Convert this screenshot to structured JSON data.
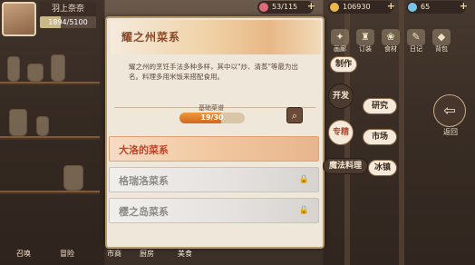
{
  "player": {
    "name": "羽上奈奈",
    "exp_text": "1894/5100",
    "exp_fraction": 0.371
  },
  "resources": [
    {
      "name": "heart-icon",
      "value": "53/115",
      "color": "#e06a7a"
    },
    {
      "name": "coin-icon",
      "value": "106930",
      "color": "#e8b94a"
    },
    {
      "name": "diamond-icon",
      "value": "65",
      "color": "#7ac4e8"
    }
  ],
  "panel": {
    "title": "耀之州菜系",
    "description": "耀之州的烹饪手法多种多样，其中以\"炒、清蒸\"等最为出名。料理多用米饭来搭配食用。",
    "basic_label": "基础菜谱",
    "progress_text": "19/30",
    "progress_fraction": 0.633
  },
  "cuisines": [
    {
      "label": "大洛的菜系",
      "state": "active"
    },
    {
      "label": "格瑞洛菜系",
      "state": "locked"
    },
    {
      "label": "樱之岛菜系",
      "state": "locked"
    }
  ],
  "top_menu": [
    "画廊",
    "订装",
    "食材",
    "日记",
    "背包"
  ],
  "side_menu": {
    "make": "制作",
    "develop": "开发",
    "research": "研究",
    "special": "专精",
    "market": "市场",
    "magic": "魔法料理",
    "ice": "冰镇"
  },
  "back_label": "返回",
  "bottom_labels": [
    "召唤",
    "冒险",
    "市商",
    "厨房",
    "美食"
  ]
}
